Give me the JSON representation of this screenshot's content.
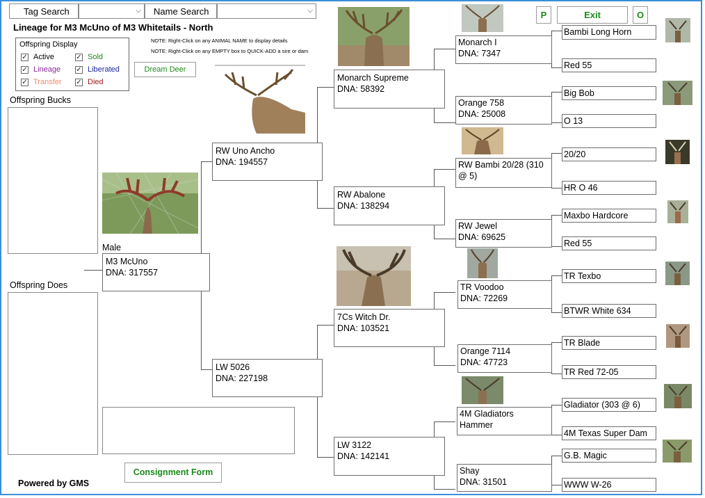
{
  "top_bar": {
    "tag_search_label": "Tag Search",
    "name_search_label": "Name Search"
  },
  "page_title": "Lineage for M3 McUno of M3 Whitetails - North",
  "notes": {
    "note1": "NOTE: Right-Click on any ANIMAL NAME to display details",
    "note2": "NOTE: Right-Click on any EMPTY box to QUICK-ADD a sire or dam"
  },
  "offspring_display": {
    "title": "Offspring Display",
    "items": [
      {
        "label": "Active",
        "color": "#000000"
      },
      {
        "label": "Sold",
        "color": "#1a8a1a"
      },
      {
        "label": "Lineage",
        "color": "#8a2a9a"
      },
      {
        "label": "Liberated",
        "color": "#1a2a9a"
      },
      {
        "label": "Transfer",
        "color": "#f08a6a"
      },
      {
        "label": "Died",
        "color": "#a01a1a"
      }
    ]
  },
  "buttons": {
    "dream_deer": "Dream Deer",
    "p": "P",
    "exit": "Exit",
    "o": "O",
    "consignment": "Consignment Form"
  },
  "offspring_bucks_label": "Offspring Bucks",
  "offspring_does_label": "Offspring Does",
  "powered_by": "Powered by GMS",
  "subject": {
    "sex": "Male",
    "name": "M3 McUno",
    "dna": "DNA: 317557"
  },
  "gen1": {
    "sire": {
      "name": "RW Uno Ancho",
      "dna": "DNA:  194557"
    },
    "dam": {
      "name": "LW 5026",
      "dna": "DNA:  227198"
    }
  },
  "gen2": {
    "a": {
      "name": "Monarch Supreme",
      "dna": "DNA: 58392"
    },
    "b": {
      "name": "RW Abalone",
      "dna": "DNA:  138294"
    },
    "c": {
      "name": "7Cs Witch Dr.",
      "dna": "DNA:  103521"
    },
    "d": {
      "name": "LW 3122",
      "dna": "DNA:  142141"
    }
  },
  "gen3": {
    "a": {
      "name": "Monarch I",
      "dna": "DNA:  7347"
    },
    "b": {
      "name": "Orange 758",
      "dna": "DNA:  25008"
    },
    "c": {
      "name": "RW Bambi 20/28 (310 @ 5)",
      "dna": ""
    },
    "d": {
      "name": "RW Jewel",
      "dna": "DNA:  69625"
    },
    "e": {
      "name": "TR Voodoo",
      "dna": "DNA:  72269"
    },
    "f": {
      "name": "Orange 7114",
      "dna": "DNA:  47723"
    },
    "g": {
      "name": "4M Gladiators Hammer",
      "dna": ""
    },
    "h": {
      "name": "Shay",
      "dna": "DNA:  31501"
    }
  },
  "gen4": [
    "Bambi Long Horn",
    "Red 55",
    "Big Bob",
    "O 13",
    "20/20",
    "HR O 46",
    "Maxbo Hardcore",
    "Red 55",
    "TR Texbo",
    "BTWR White 634",
    "TR Blade",
    "TR Red 72-05",
    "Gladiator (303 @ 6)",
    "4M Texas Super Dam",
    "G.B. Magic",
    "WWW W-26"
  ]
}
